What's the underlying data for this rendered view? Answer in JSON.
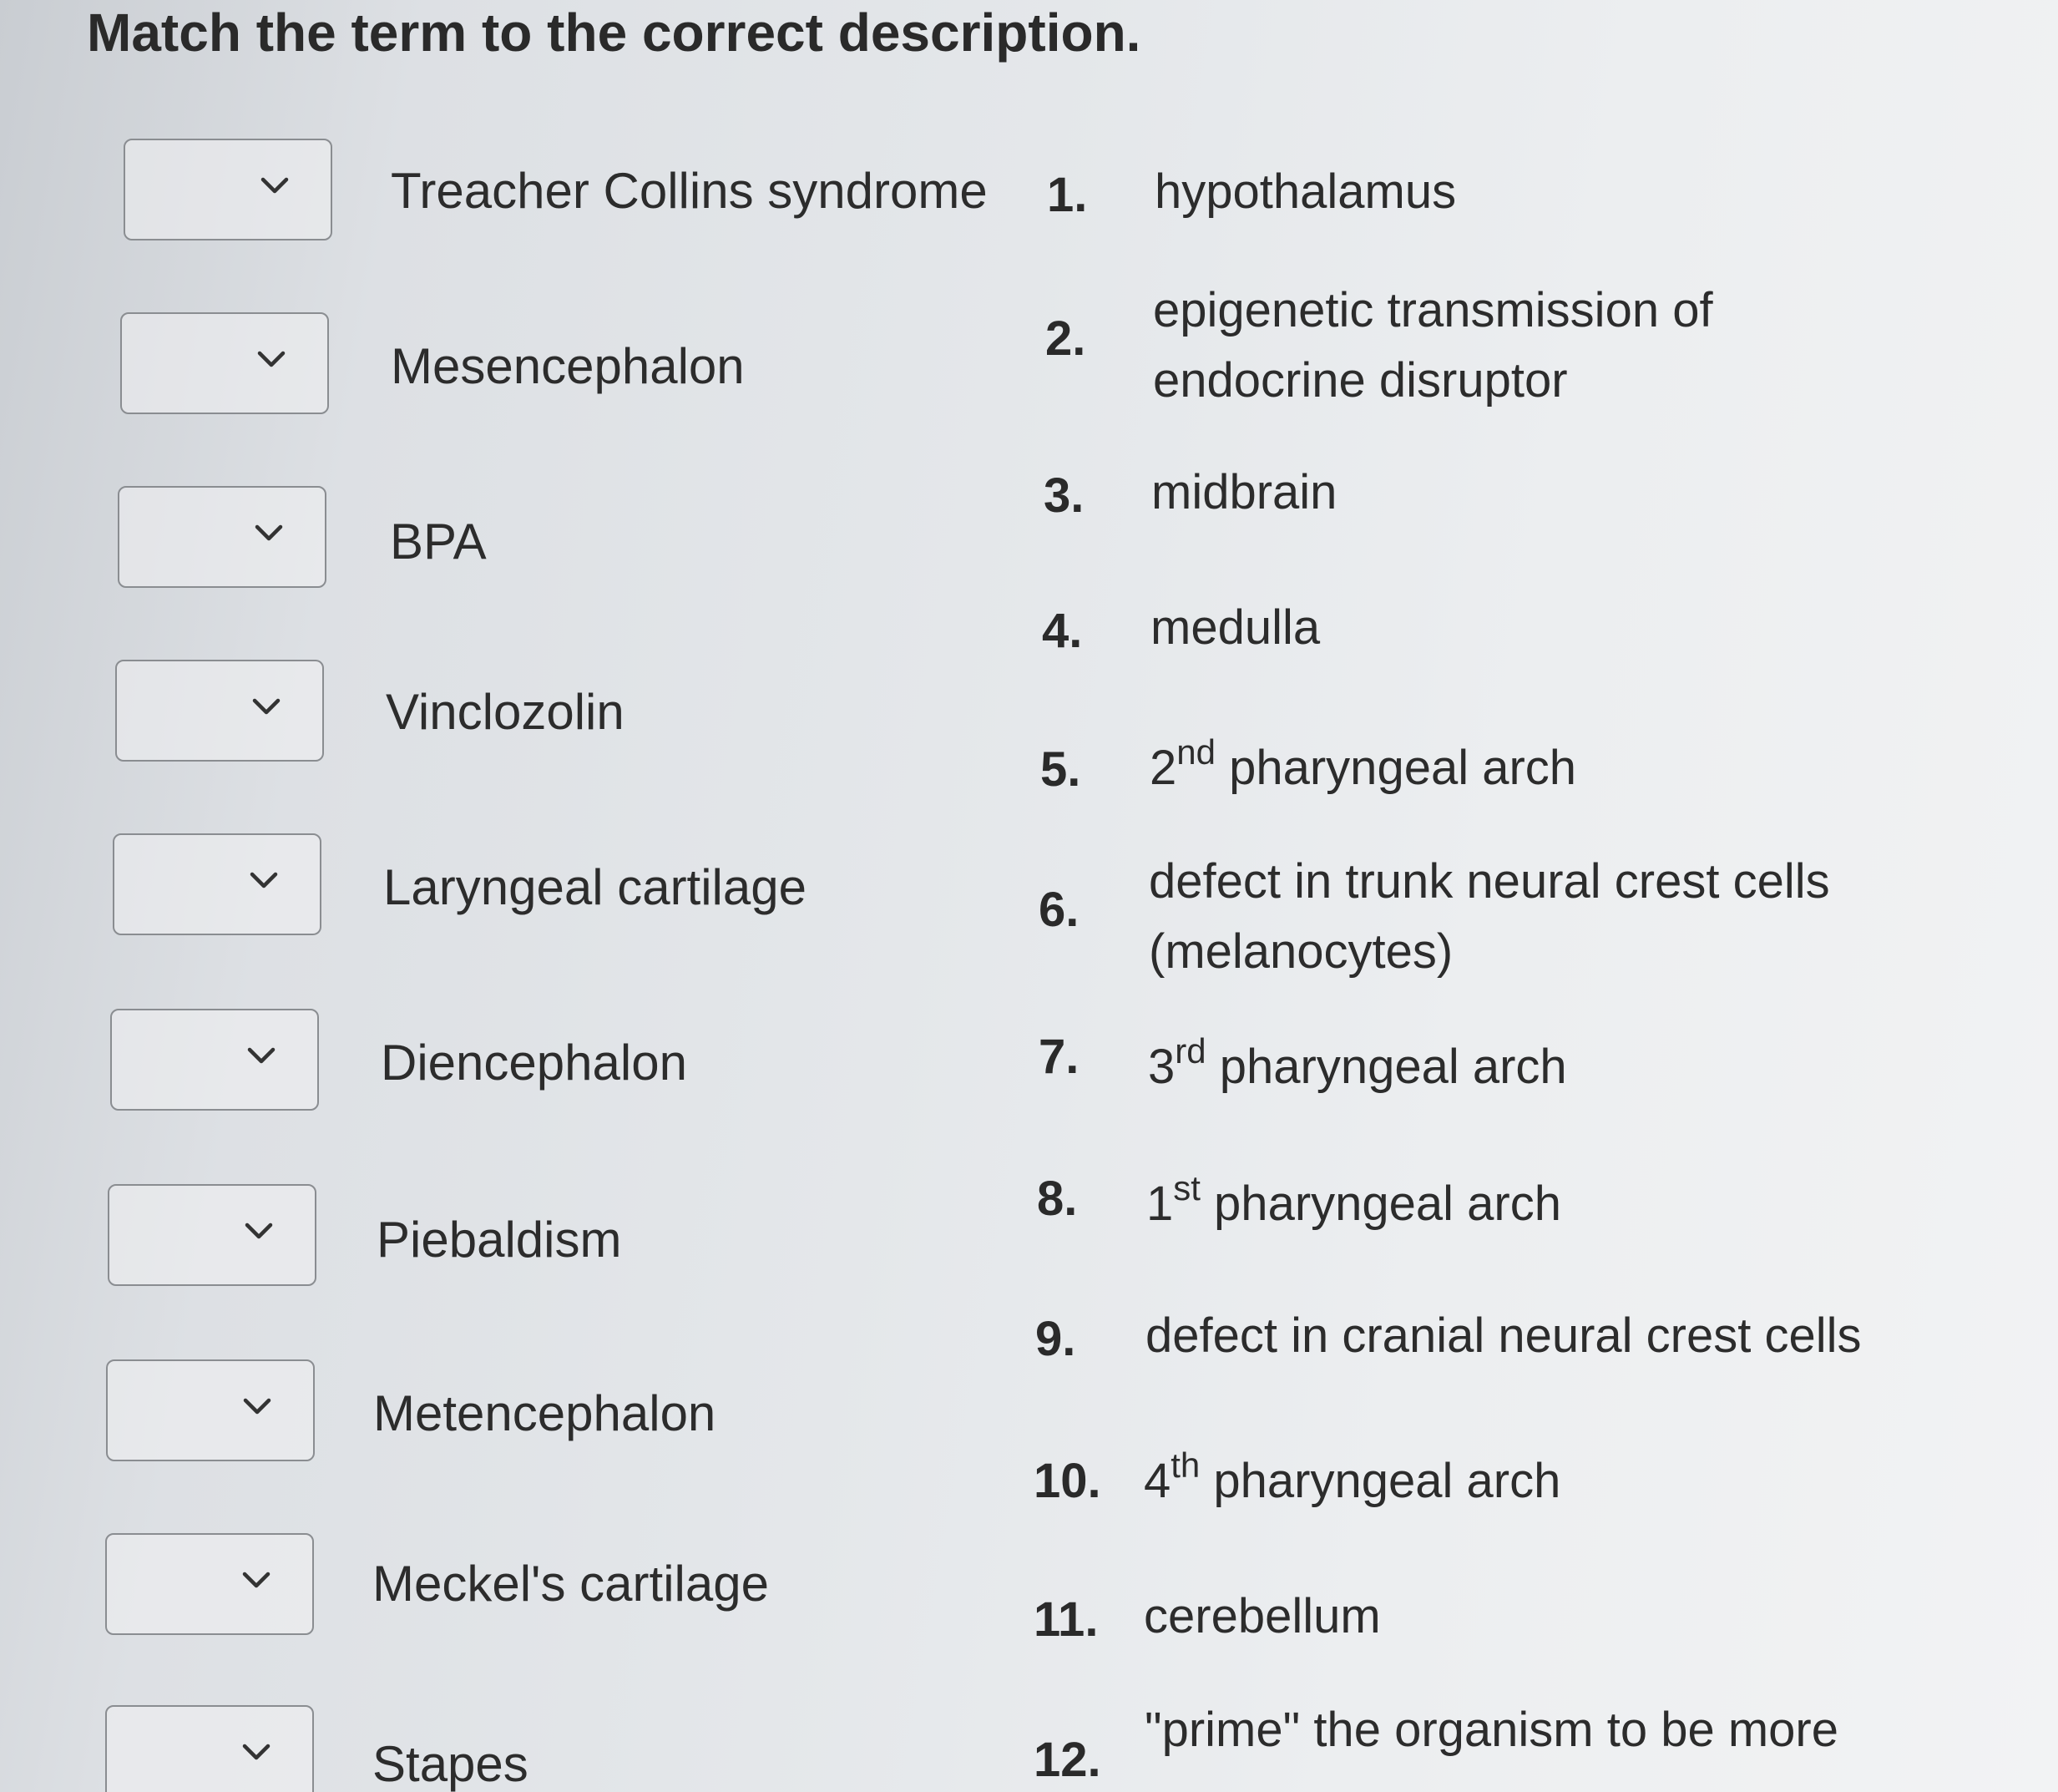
{
  "question": {
    "title": "Match the term to the correct description."
  },
  "terms": [
    {
      "label": "Treacher Collins syndrome",
      "selected": ""
    },
    {
      "label": "Mesencephalon",
      "selected": ""
    },
    {
      "label": "BPA",
      "selected": ""
    },
    {
      "label": "Vinclozolin",
      "selected": ""
    },
    {
      "label": "Laryngeal cartilage",
      "selected": ""
    },
    {
      "label": "Diencephalon",
      "selected": ""
    },
    {
      "label": "Piebaldism",
      "selected": ""
    },
    {
      "label": "Metencephalon",
      "selected": ""
    },
    {
      "label": "Meckel's cartilage",
      "selected": ""
    },
    {
      "label": "Stapes",
      "selected": ""
    }
  ],
  "descriptions": [
    {
      "num": "1.",
      "line1": "hypothalamus",
      "line2": ""
    },
    {
      "num": "2.",
      "line1": "epigenetic transmission of",
      "line2": "endocrine disruptor"
    },
    {
      "num": "3.",
      "line1": "midbrain",
      "line2": ""
    },
    {
      "num": "4.",
      "line1": "medulla",
      "line2": ""
    },
    {
      "num": "5.",
      "base": "2",
      "sup": "nd",
      "rest": " pharyngeal arch"
    },
    {
      "num": "6.",
      "line1": "defect in trunk neural crest cells",
      "line2": "(melanocytes)"
    },
    {
      "num": "7.",
      "base": "3",
      "sup": "rd",
      "rest": " pharyngeal arch"
    },
    {
      "num": "8.",
      "base": "1",
      "sup": "st",
      "rest": " pharyngeal arch"
    },
    {
      "num": "9.",
      "line1": "defect in cranial neural crest cells",
      "line2": ""
    },
    {
      "num": "10.",
      "base": "4",
      "sup": "th",
      "rest": " pharyngeal arch"
    },
    {
      "num": "11.",
      "line1": "cerebellum",
      "line2": ""
    },
    {
      "num": "12.",
      "line1": "\"prime\" the organism to be more",
      "line2": ""
    }
  ],
  "icons": {
    "dropdown": "chevron-down-icon"
  },
  "colors": {
    "dropdown_border": "#8a8d91",
    "text": "#2c2c2c"
  }
}
